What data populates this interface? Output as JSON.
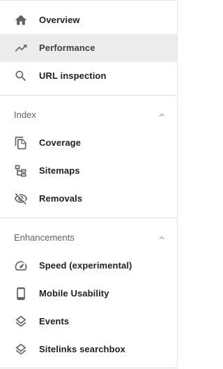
{
  "nav": {
    "items": [
      {
        "label": "Overview",
        "icon": "home-icon"
      },
      {
        "label": "Performance",
        "icon": "trending-up-icon",
        "active": true
      },
      {
        "label": "URL inspection",
        "icon": "search-icon"
      }
    ]
  },
  "index_section": {
    "title": "Index",
    "items": [
      {
        "label": "Coverage",
        "icon": "file-copy-icon"
      },
      {
        "label": "Sitemaps",
        "icon": "sitemap-icon"
      },
      {
        "label": "Removals",
        "icon": "visibility-off-icon"
      }
    ]
  },
  "enhancements_section": {
    "title": "Enhancements",
    "items": [
      {
        "label": "Speed (experimental)",
        "icon": "speedometer-icon"
      },
      {
        "label": "Mobile Usability",
        "icon": "smartphone-icon"
      },
      {
        "label": "Events",
        "icon": "layers-icon"
      },
      {
        "label": "Sitelinks searchbox",
        "icon": "layers-icon"
      }
    ]
  },
  "colors": {
    "text": "#202124",
    "icon": "#5f6368",
    "active_bg": "#ececec",
    "divider": "#e0e0e0"
  }
}
